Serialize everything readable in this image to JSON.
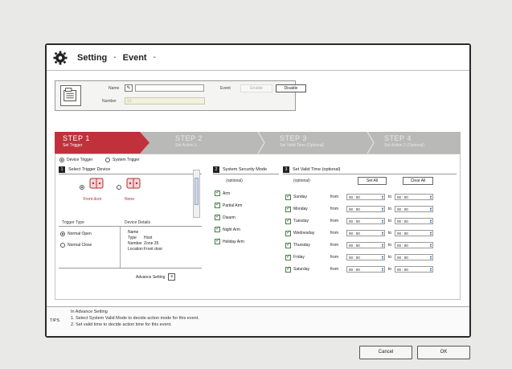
{
  "titlebar": {
    "crumbs": [
      "Setting",
      "Event"
    ],
    "separator": "-"
  },
  "info": {
    "name_label": "Name",
    "number_label": "Number",
    "number_value": "13",
    "event_label": "Event",
    "enable_label": "Enable",
    "disable_label": "Disable"
  },
  "steps": [
    {
      "title": "STEP 1",
      "sub": "Set Trigger"
    },
    {
      "title": "STEP 2",
      "sub": "Set Action 1"
    },
    {
      "title": "STEP 3",
      "sub": "Set Valid Time (Optional)"
    },
    {
      "title": "STEP 4",
      "sub": "Set Action 2 (Optional)"
    }
  ],
  "trigger": {
    "device_trigger": "Device Trigger",
    "system_trigger": "System Trigger",
    "section_num": "1",
    "section_title": "Select Trigger Device",
    "devices": [
      {
        "name": "Front door"
      },
      {
        "name": "None"
      }
    ],
    "trigger_type_label": "Trigger Type",
    "device_details_label": "Device Details",
    "types": [
      "Normal Open",
      "Normal Close"
    ],
    "details": [
      {
        "k": "Name",
        "v": ""
      },
      {
        "k": "Type",
        "v": "Host"
      },
      {
        "k": "Number",
        "v": "Zone 35"
      },
      {
        "k": "Location",
        "v": "Front door"
      }
    ],
    "advance_setting": "Advance Setting",
    "plus": "+"
  },
  "mode": {
    "section_num": "2",
    "section_title": "System Security Mode",
    "optional": "(optional)",
    "items": [
      "Arm",
      "Partial Arm",
      "Disarm",
      "Night Arm",
      "Holiday Arm"
    ]
  },
  "valid_time": {
    "section_num": "3",
    "section_title": "Set Valid Time (optional)",
    "optional": "(optional)",
    "set_all": "Set All",
    "clear_all": "Clear All",
    "from": "from",
    "to": "to",
    "days": [
      {
        "day": "Sunday",
        "from": "00 : 00",
        "to": "00 : 00"
      },
      {
        "day": "Monday",
        "from": "00 : 00",
        "to": "00 : 00"
      },
      {
        "day": "Tuesday",
        "from": "00 : 00",
        "to": "00 : 00"
      },
      {
        "day": "Wednesday",
        "from": "00 : 00",
        "to": "00 : 00"
      },
      {
        "day": "Thursday",
        "from": "00 : 00",
        "to": "00 : 00"
      },
      {
        "day": "Friday",
        "from": "00 : 00",
        "to": "00 : 00"
      },
      {
        "day": "Saturday",
        "from": "00 : 00",
        "to": "00 : 00"
      }
    ]
  },
  "tips": {
    "label": "TIPS",
    "lines": [
      "In Advance Setting",
      "1. Select System Valid Mode to decide action mode for this event.",
      "2. Set valid time to decide action time for this event."
    ]
  },
  "buttons": {
    "cancel": "Cancel",
    "ok": "OK"
  },
  "colors": {
    "step_active": "#c0313c",
    "step_inactive": "#b9b9b7"
  }
}
